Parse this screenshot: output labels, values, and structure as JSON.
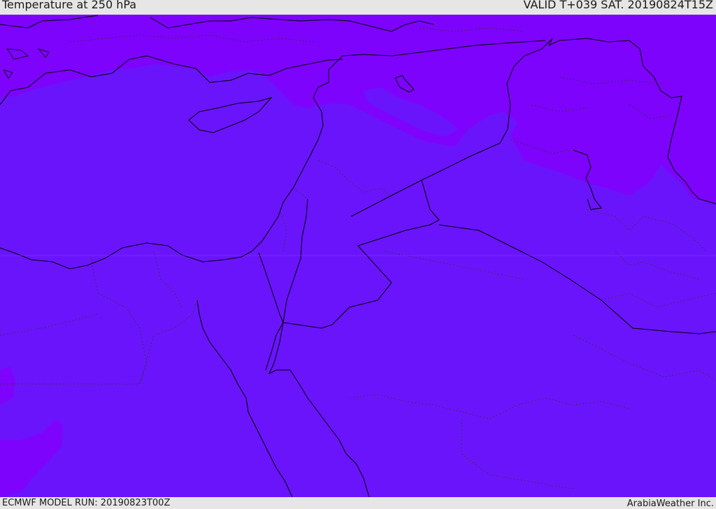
{
  "header": {
    "title": "Temperature at 250 hPa",
    "valid": "VALID T+039 SAT. 20190824T15Z"
  },
  "footer": {
    "model_run": "ECMWF MODEL RUN: 20190823T00Z",
    "credit": "ArabiaWeather Inc."
  },
  "colors": {
    "warmer_band": "#6a14fc",
    "colder_band": "#7d03fc",
    "coastline": "#000000",
    "border": "#000000",
    "inner_border": "#333333",
    "bar_background": "#e6e6e6"
  }
}
